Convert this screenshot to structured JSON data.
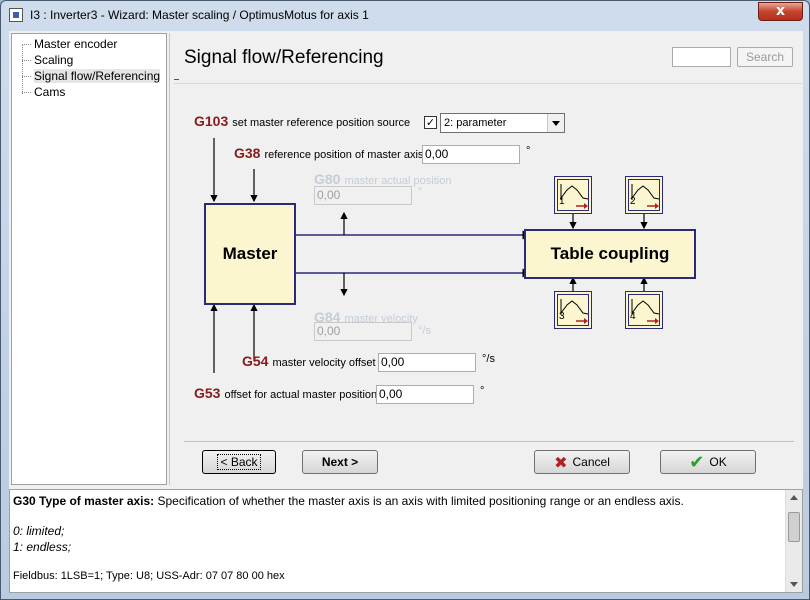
{
  "window": {
    "title": "I3 : Inverter3 - Wizard: Master scaling / OptimusMotus for axis 1",
    "close_label": "x"
  },
  "tree": {
    "items": [
      {
        "label": "Master encoder"
      },
      {
        "label": "Scaling"
      },
      {
        "label": "Signal flow/Referencing"
      },
      {
        "label": "Cams"
      }
    ]
  },
  "header": {
    "title": "Signal flow/Referencing",
    "search_label": "Search",
    "search_value": ""
  },
  "params": {
    "g103": {
      "code": "G103",
      "label": "set master reference position source",
      "checked": "✓",
      "select_value": "2: parameter"
    },
    "g38": {
      "code": "G38",
      "label": "reference position of master axis",
      "value": "0,00",
      "unit": "°"
    },
    "g80": {
      "code": "G80",
      "label": "master actual position",
      "value": "0,00",
      "unit": "°"
    },
    "g84": {
      "code": "G84",
      "label": "master velocity",
      "value": "0,00",
      "unit": "°/s"
    },
    "g54": {
      "code": "G54",
      "label": "master velocity offset",
      "value": "0,00",
      "unit": "°/s"
    },
    "g53": {
      "code": "G53",
      "label": "offset for actual master position",
      "value": "0,00",
      "unit": "°"
    }
  },
  "diagram": {
    "master_label": "Master",
    "table_label": "Table coupling",
    "cams": [
      "1",
      "2",
      "3",
      "4"
    ]
  },
  "buttons": {
    "back": "< Back",
    "next": "Next >",
    "cancel": "Cancel",
    "ok": "OK"
  },
  "help": {
    "title": "G30  Type of master axis:",
    "description": " Specification of whether the master axis is an axis with limited positioning range or an endless axis.",
    "option0": "0:  limited;",
    "option1": "1:  endless;",
    "fieldbus": "Fieldbus: 1LSB=1; Type: U8; USS-Adr: 07 07 80 00 hex"
  },
  "colors": {
    "param_code": "#8b1a1a",
    "block_fill": "#fbf6cf",
    "block_border": "#2a2a7a",
    "disabled_text": "#c4cdd8"
  }
}
